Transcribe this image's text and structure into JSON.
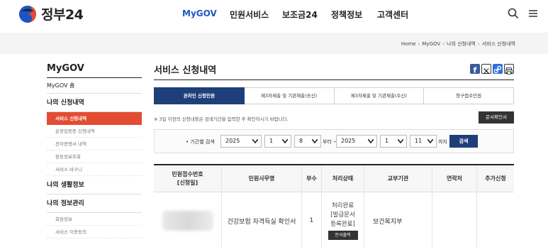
{
  "header": {
    "logo_text": "정부24",
    "nav": [
      "MyGOV",
      "민원서비스",
      "보조금24",
      "정책정보",
      "고객센터"
    ],
    "active_nav": "MyGOV"
  },
  "breadcrumb": [
    "Home",
    "MyGOV",
    "나의 신청내역",
    "서비스 신청내역"
  ],
  "sidebar": {
    "title": "MyGOV",
    "home": "MyGOV 홈",
    "group1": "나의 신청내역",
    "group1_items": [
      "서비스 신청내역",
      "온정임등등 신청내역",
      "전자증명서 내역",
      "환동정보조회",
      "서비스 바구니"
    ],
    "group2": "나의 생활정보",
    "group3": "나의 정보관리",
    "group3_items": [
      "회원정보",
      "서비스 이용동의"
    ]
  },
  "main": {
    "title": "서비스 신청내역",
    "tabs": [
      "온라인 신청민원",
      "제3자제출 및 기관제출(송신)",
      "제3자제출 및 기관제출(수신)",
      "청구접수민원"
    ],
    "notice": "※ 3일 이전의 신청내용은 검색기간을 입력한 후 확인하시기 바랍니다.",
    "doc_button": "문서확인서",
    "search": {
      "label": "• 기간별 검색",
      "from_year": "2025",
      "from_month": "1",
      "from_day": "8",
      "from_suffix": "부터 ~",
      "to_year": "2025",
      "to_month": "1",
      "to_day": "11",
      "to_suffix": "까지",
      "button": "검색"
    },
    "table": {
      "headers": [
        "민원접수번호\n[신청일]",
        "민원사무명",
        "부수",
        "처리상태",
        "교부기관",
        "연락처",
        "추가신청"
      ],
      "row": {
        "service": "건강보험 자격득실 확인서",
        "count": "1",
        "status_lines": [
          "처리완료",
          "[발급문서",
          "등록완료]"
        ],
        "status_button": "문서출력",
        "agency": "보건복지부"
      }
    }
  },
  "colors": {
    "brand": "#1c56c4",
    "accent_red": "#e24c32",
    "tab_active": "#1f3f7a"
  }
}
